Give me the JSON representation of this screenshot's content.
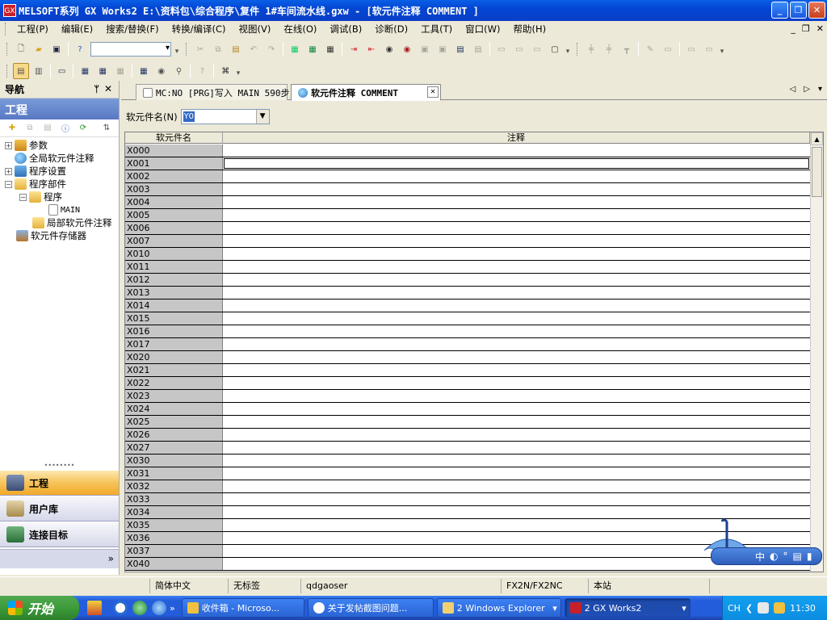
{
  "window": {
    "title": "MELSOFT系列 GX Works2 E:\\资料包\\综合程序\\复件 1#车间流水线.gxw - [软元件注释 COMMENT ]",
    "logo": "GX"
  },
  "menu": [
    "工程(P)",
    "编辑(E)",
    "搜索/替换(F)",
    "转换/编译(C)",
    "视图(V)",
    "在线(O)",
    "调试(B)",
    "诊断(D)",
    "工具(T)",
    "窗口(W)",
    "帮助(H)"
  ],
  "nav": {
    "header": "导航",
    "project_title": "工程",
    "tree": [
      {
        "label": "参数",
        "icon": "param-icon"
      },
      {
        "label": "全局软元件注释",
        "icon": "globe-icon"
      },
      {
        "label": "程序设置",
        "icon": "program-settings-icon"
      },
      {
        "label": "程序部件",
        "icon": "folder-icon"
      },
      {
        "label": "程序",
        "icon": "folder-icon"
      },
      {
        "label": "MAIN",
        "icon": "program-file-icon"
      },
      {
        "label": "局部软元件注释",
        "icon": "folder-icon"
      },
      {
        "label": "软元件存储器",
        "icon": "device-memory-icon"
      }
    ],
    "buttons": {
      "project": "工程",
      "user_library": "用户库",
      "connection": "连接目标"
    },
    "more": "»"
  },
  "tabs": {
    "main": "MC:NO [PRG]写入 MAIN 590步",
    "comment": "软元件注释 COMMENT"
  },
  "editor": {
    "device_label": "软元件名(N)",
    "device_value": "Y0",
    "col_device": "软元件名",
    "col_comment": "注释",
    "rows": [
      "X000",
      "X001",
      "X002",
      "X003",
      "X004",
      "X005",
      "X006",
      "X007",
      "X010",
      "X011",
      "X012",
      "X013",
      "X014",
      "X015",
      "X016",
      "X017",
      "X020",
      "X021",
      "X022",
      "X023",
      "X024",
      "X025",
      "X026",
      "X027",
      "X030",
      "X031",
      "X032",
      "X033",
      "X034",
      "X035",
      "X036",
      "X037",
      "X040"
    ]
  },
  "ime": {
    "text": "中"
  },
  "status": {
    "language": "简体中文",
    "label": "无标签",
    "user": "qdgaoser",
    "plc": "FX2N/FX2NC",
    "station": "本站"
  },
  "taskbar": {
    "start": "开始",
    "tasks": [
      {
        "label": "收件箱 - Microso...",
        "active": false
      },
      {
        "label": "关于发帖截图问题...",
        "active": false
      },
      {
        "label": "2 Windows Explorer",
        "active": false
      },
      {
        "label": "2 GX Works2",
        "active": true
      }
    ],
    "tray_lang": "CH",
    "clock": "11:30"
  }
}
